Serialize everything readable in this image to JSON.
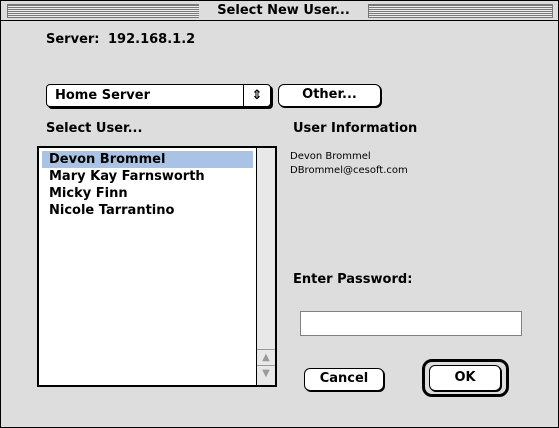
{
  "window": {
    "title": "Select New User..."
  },
  "server": {
    "label": "Server:",
    "value": "192.168.1.2"
  },
  "server_popup": {
    "selected": "Home Server",
    "arrow": "⇕"
  },
  "buttons": {
    "other": "Other...",
    "cancel": "Cancel",
    "ok": "OK"
  },
  "select_user": {
    "label": "Select User...",
    "items": [
      {
        "name": "Devon Brommel",
        "selected": true
      },
      {
        "name": "Mary Kay Farnsworth",
        "selected": false
      },
      {
        "name": "Micky Finn",
        "selected": false
      },
      {
        "name": "Nicole Tarrantino",
        "selected": false
      }
    ]
  },
  "user_info": {
    "label": "User Information",
    "name": "Devon Brommel",
    "email": "DBrommel@cesoft.com"
  },
  "password": {
    "label": "Enter Password:",
    "value": ""
  },
  "colors": {
    "selection": "#a9c3e4",
    "window_bg": "#dddddd"
  }
}
